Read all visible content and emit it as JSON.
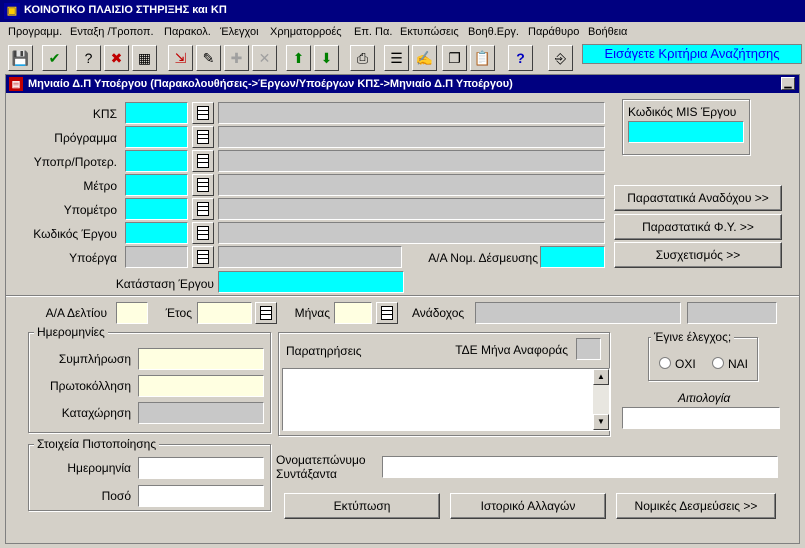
{
  "app": {
    "title": "ΚΟΙΝΟΤΙΚΟ ΠΛΑΙΣΙΟ ΣΤΗΡΙΞΗΣ και ΚΠ"
  },
  "menu": [
    "Προγραμμ.",
    "Ενταξη /Τροποπ.",
    "Παρακολ.",
    "Έλεγχοι",
    "Χρηματορροές",
    "Επ. Πα.",
    "Εκτυπώσεις",
    "Βοηθ.Εργ.",
    "Παράθυρο",
    "Βοήθεια"
  ],
  "toolbar": {
    "hint": "Εισάγετε Κριτήρια Αναζήτησης",
    "icons": [
      "save-icon",
      "check-icon",
      "query-icon",
      "cancel-query-icon",
      "calculator-icon",
      "exit-icon",
      "edit-icon",
      "add-icon",
      "delete-icon",
      "up-arrow-icon",
      "down-arrow-icon",
      "print-icon",
      "list-icon",
      "edit-note-icon",
      "copy-icon",
      "paste-icon",
      "help-icon",
      "exit-door-icon"
    ]
  },
  "window": {
    "title": "Μηνιαίο Δ.Π Υποέργου (Παρακολουθήσεις->Έργων/Υποέργων ΚΠΣ->Μηνιαίο Δ.Π Υποέργου)",
    "minimize": "▁"
  },
  "form": {
    "top_labels": [
      "ΚΠΣ",
      "Πρόγραμμα",
      "Υποπρ/Προτερ.",
      "Μέτρο",
      "Υπομέτρο",
      "Κωδικός Έργου",
      "Υποέργα"
    ],
    "aa_nom_desmeysis": "Α/Α Νομ. Δέσμευσης",
    "katastasi_ergou": "Κατάσταση Έργου",
    "mis_code": "Κωδικός MIS Έργου",
    "buttons_right": [
      "Παραστατικά Αναδόχου >>",
      "Παραστατικά Φ.Υ. >>",
      "Συσχετισμός >>"
    ],
    "aa_deltiou": "Α/Α Δελτίου",
    "etos": "Έτος",
    "minas": "Μήνας",
    "anadoxos": "Ανάδοχος",
    "dates_group": "Ημερομηνίες",
    "date_labels": [
      "Συμπλήρωση",
      "Πρωτοκόλληση",
      "Καταχώρηση"
    ],
    "cert_group": "Στοιχεία Πιστοποίησης",
    "cert_labels": [
      "Ημερομηνία",
      "Ποσό"
    ],
    "notes": "Παρατηρήσεις",
    "tde_month": "ΤΔΕ Μήνα Αναφοράς",
    "check_group": "Έγινε έλεγχος;",
    "radio_no": "ΟΧΙ",
    "radio_yes": "ΝΑΙ",
    "reason": "Αιτιολογία",
    "author_line1": "Ονοματεπώνυμο",
    "author_line2": "Συντάξαντα",
    "buttons_bottom": [
      "Εκτύπωση",
      "Ιστορικό Αλλαγών",
      "Νομικές Δεσμεύσεις >>"
    ]
  }
}
